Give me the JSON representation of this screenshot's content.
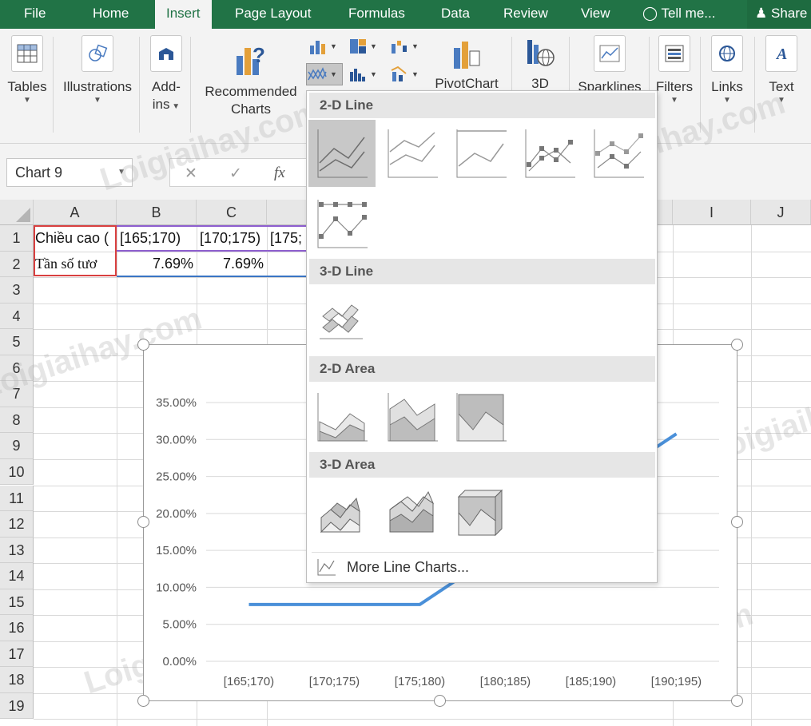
{
  "tabs": {
    "file": "File",
    "home": "Home",
    "insert": "Insert",
    "page_layout": "Page Layout",
    "formulas": "Formulas",
    "data": "Data",
    "review": "Review",
    "view": "View",
    "tell_me": "Tell me...",
    "share": "Share"
  },
  "ribbon": {
    "tables": "Tables",
    "illustrations": "Illustrations",
    "addins_line1": "Add-",
    "addins_line2": "ins",
    "recommended_line1": "Recommended",
    "recommended_line2": "Charts",
    "pivotchart": "PivotChart",
    "threed": "3D",
    "sparklines": "Sparklines",
    "filters": "Filters",
    "links": "Links",
    "text": "Text"
  },
  "formula_bar": {
    "name_box": "Chart 9",
    "fx": "fx"
  },
  "grid": {
    "columns": [
      "A",
      "B",
      "C",
      "I",
      "J"
    ],
    "rows": [
      "1",
      "2",
      "3",
      "4",
      "5",
      "6",
      "7",
      "8",
      "9",
      "10",
      "11",
      "12",
      "13",
      "14",
      "15",
      "16",
      "17",
      "18",
      "19"
    ],
    "cells": {
      "A1": "Chiều cao (",
      "B1": "[165;170)",
      "C1": "[170;175)",
      "D1": "[175;",
      "A2": "Tần số tươ",
      "B2": "7.69%",
      "C2": "7.69%"
    }
  },
  "dropdown": {
    "sections": {
      "line_2d": "2-D Line",
      "line_3d": "3-D Line",
      "area_2d": "2-D Area",
      "area_3d": "3-D Area"
    },
    "more": "More Line Charts..."
  },
  "chart_data": {
    "type": "line",
    "categories": [
      "[165;170)",
      "[170;175)",
      "[175;180)",
      "[180;185)",
      "[185;190)",
      "[190;195)"
    ],
    "series": [
      {
        "values": [
          7.69,
          7.69,
          7.69,
          15.38,
          23.08,
          30.77
        ],
        "color": "#4a90d9"
      }
    ],
    "ylim": [
      0,
      35
    ],
    "y_ticks": [
      "0.00%",
      "5.00%",
      "10.00%",
      "15.00%",
      "20.00%",
      "25.00%",
      "30.00%",
      "35.00%"
    ],
    "y_tick_values": [
      0,
      5,
      10,
      15,
      20,
      25,
      30,
      35
    ],
    "grid": true,
    "title": "",
    "xlabel": "",
    "ylabel": ""
  },
  "watermark": "Loigiaihay.com"
}
